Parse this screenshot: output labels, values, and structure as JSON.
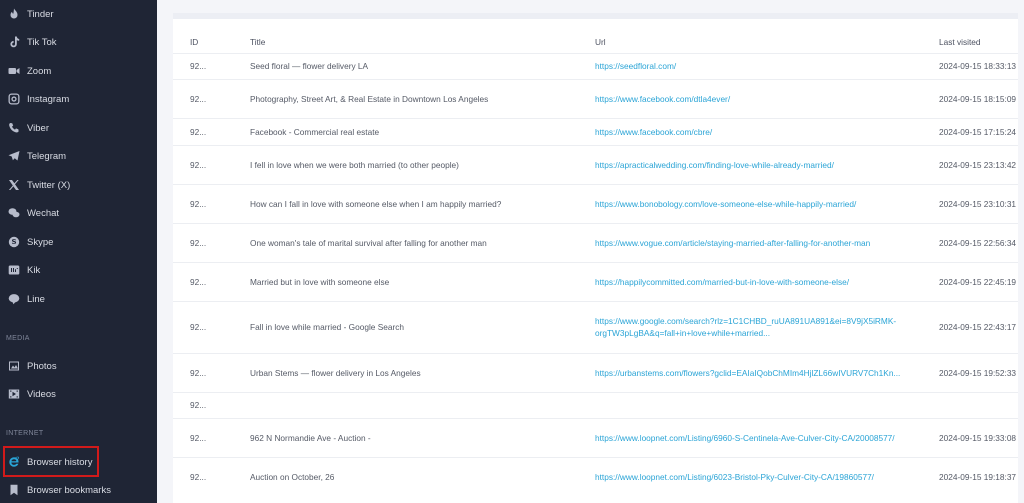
{
  "sidebar": {
    "items": [
      {
        "label": "Tinder",
        "icon": "tinder-flame-icon"
      },
      {
        "label": "Tik Tok",
        "icon": "tiktok-icon"
      },
      {
        "label": "Zoom",
        "icon": "zoom-camera-icon"
      },
      {
        "label": "Instagram",
        "icon": "instagram-icon"
      },
      {
        "label": "Viber",
        "icon": "viber-phone-icon"
      },
      {
        "label": "Telegram",
        "icon": "telegram-plane-icon"
      },
      {
        "label": "Twitter (X)",
        "icon": "x-logo-icon"
      },
      {
        "label": "Wechat",
        "icon": "wechat-icon"
      },
      {
        "label": "Skype",
        "icon": "skype-icon"
      },
      {
        "label": "Kik",
        "icon": "kik-icon"
      },
      {
        "label": "Line",
        "icon": "line-icon"
      }
    ],
    "media_section": "MEDIA",
    "media_items": [
      {
        "label": "Photos",
        "icon": "photos-icon"
      },
      {
        "label": "Videos",
        "icon": "videos-icon"
      }
    ],
    "internet_section": "INTERNET",
    "internet_items": [
      {
        "label": "Browser history",
        "icon": "browser-e-icon",
        "active": true
      },
      {
        "label": "Browser bookmarks",
        "icon": "bookmark-icon"
      }
    ],
    "active_highlight_color": "#d11a1a"
  },
  "table": {
    "headers": {
      "id": "ID",
      "title": "Title",
      "url": "Url",
      "last": "Last visited"
    },
    "rows": [
      {
        "id": "92...",
        "title": "Seed floral — flower delivery LA",
        "url": "https://seedfloral.com/",
        "last": "2024-09-15 18:33:13"
      },
      {
        "id": "92...",
        "title": "Photography, Street Art, & Real Estate in Downtown Los Angeles",
        "url": "https://www.facebook.com/dtla4ever/",
        "last": "2024-09-15 18:15:09"
      },
      {
        "id": "92...",
        "title": "Facebook - Commercial real estate",
        "url": "https://www.facebook.com/cbre/",
        "last": "2024-09-15 17:15:24"
      },
      {
        "id": "92...",
        "title": "I fell in love when we were both married (to other people)",
        "url": "https://apracticalwedding.com/finding-love-while-already-married/",
        "last": "2024-09-15 23:13:42"
      },
      {
        "id": "92...",
        "title": "How can I fall in love with someone else when I am happily married?",
        "url": "https://www.bonobology.com/love-someone-else-while-happily-married/",
        "last": "2024-09-15 23:10:31"
      },
      {
        "id": "92...",
        "title": "One woman's tale of marital survival after falling for another man",
        "url": "https://www.vogue.com/article/staying-married-after-falling-for-another-man",
        "last": "2024-09-15 22:56:34"
      },
      {
        "id": "92...",
        "title": "Married but in love with someone else",
        "url": "https://happilycommitted.com/married-but-in-love-with-someone-else/",
        "last": "2024-09-15 22:45:19"
      },
      {
        "id": "92...",
        "title": "Fall in love while married - Google Search",
        "url": "https://www.google.com/search?rlz=1C1CHBD_ruUA891UA891&ei=8V9jX5iRMK-orgTW3pLgBA&q=fall+in+love+while+married...",
        "last": "2024-09-15 22:43:17"
      },
      {
        "id": "92...",
        "title": "Urban Stems — flower delivery in Los Angeles",
        "url": "https://urbanstems.com/flowers?gclid=EAIaIQobChMIm4HjlZL66wIVURV7Ch1Kn...",
        "last": "2024-09-15 19:52:33"
      },
      {
        "id": "92...",
        "title": "",
        "url": "",
        "last": ""
      },
      {
        "id": "92...",
        "title": "962 N Normandie Ave - Auction -",
        "url": "https://www.loopnet.com/Listing/6960-S-Centinela-Ave-Culver-City-CA/20008577/",
        "last": "2024-09-15 19:33:08"
      },
      {
        "id": "92...",
        "title": "Auction on October, 26",
        "url": "https://www.loopnet.com/Listing/6023-Bristol-Pky-Culver-City-CA/19860577/",
        "last": "2024-09-15 19:18:37"
      }
    ],
    "link_color": "#2aa4d6"
  }
}
